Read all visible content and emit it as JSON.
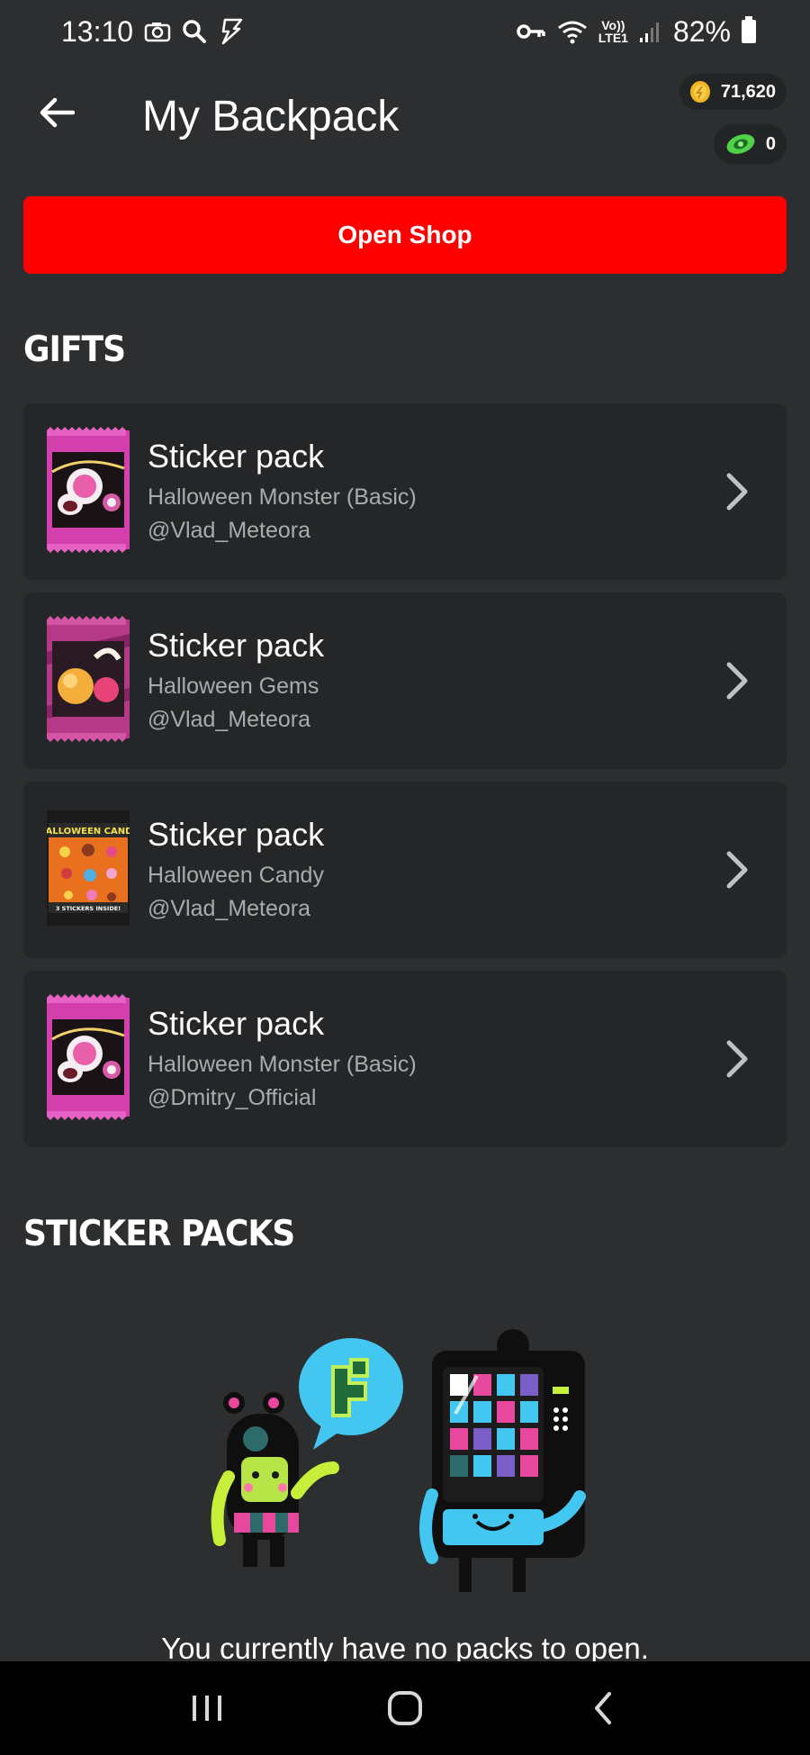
{
  "status_bar": {
    "time": "13:10",
    "network_top": "Vo))",
    "network_bottom": "LTE1",
    "battery": "82%"
  },
  "header": {
    "title": "My Backpack",
    "coins": "71,620",
    "props": "0"
  },
  "open_shop_label": "Open Shop",
  "gifts_title": "GIFTS",
  "gifts": [
    {
      "title": "Sticker pack",
      "name": "Halloween Monster (Basic)",
      "user": "@Vlad_Meteora",
      "thumb": "monster-pack"
    },
    {
      "title": "Sticker pack",
      "name": "Halloween Gems",
      "user": "@Vlad_Meteora",
      "thumb": "gems-pack"
    },
    {
      "title": "Sticker pack",
      "name": "Halloween Candy",
      "user": "@Vlad_Meteora",
      "thumb": "candy-pack"
    },
    {
      "title": "Sticker pack",
      "name": "Halloween Monster (Basic)",
      "user": "@Dmitry_Official",
      "thumb": "monster-pack"
    }
  ],
  "sticker_packs_title": "STICKER PACKS",
  "candy_pack_label": "HALLOWEEN CANDY",
  "candy_pack_footer": "3 STICKERS INSIDE!",
  "empty_message": "You currently have no packs to open.",
  "colors": {
    "background": "#2c2e2f",
    "card": "#242627",
    "accent_red": "#ff0000",
    "muted_text": "#a9abad"
  }
}
